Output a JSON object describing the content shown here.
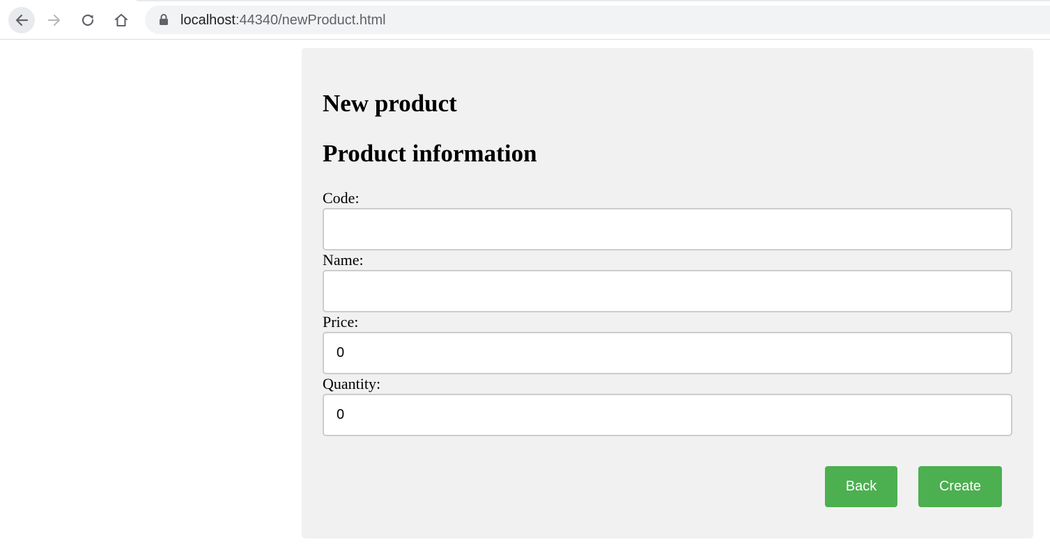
{
  "browser": {
    "url_host": "localhost",
    "url_rest": ":44340/newProduct.html",
    "icons": {
      "back": "arrow-left-icon",
      "forward": "arrow-right-icon",
      "reload": "reload-icon",
      "home": "home-icon",
      "lock": "lock-icon"
    }
  },
  "page": {
    "title": "New product",
    "section_title": "Product information",
    "fields": [
      {
        "label": "Code:",
        "value": ""
      },
      {
        "label": "Name:",
        "value": ""
      },
      {
        "label": "Price:",
        "value": "0"
      },
      {
        "label": "Quantity:",
        "value": "0"
      }
    ],
    "buttons": {
      "back": "Back",
      "create": "Create"
    }
  },
  "colors": {
    "panel_bg": "#f1f1f1",
    "button_bg": "#4caf50",
    "button_text": "#ffffff",
    "input_border": "#cccccc"
  }
}
